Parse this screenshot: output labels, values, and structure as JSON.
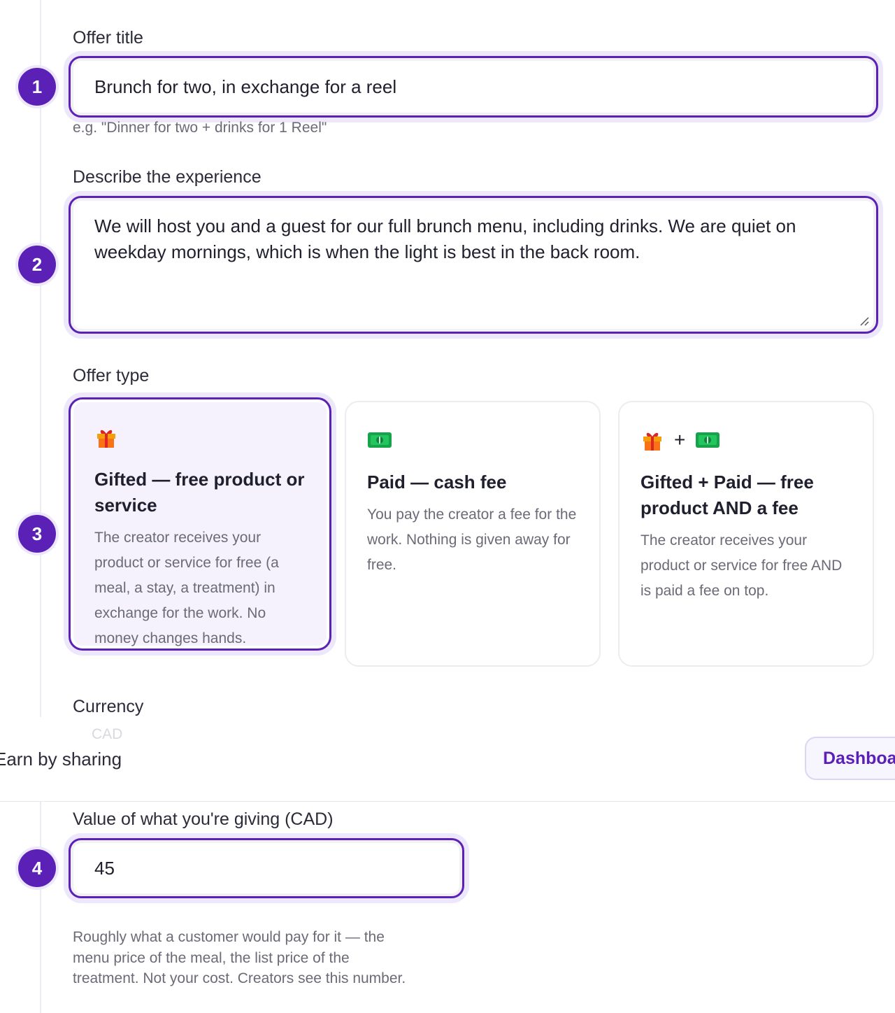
{
  "steps": [
    "1",
    "2",
    "3",
    "4"
  ],
  "offer_title": {
    "label": "Offer title",
    "value": "Brunch for two, in exchange for a reel",
    "hint": "e.g. \"Dinner for two + drinks for 1 Reel\""
  },
  "description": {
    "label": "Describe the experience",
    "value": "We will host you and a guest for our full brunch menu, including drinks. We are quiet on weekday mornings, which is when the light is best in the back room."
  },
  "offer_type": {
    "label": "Offer type",
    "selected": "gifted",
    "options": [
      {
        "title": "Gifted — free product or service",
        "body": "The creator receives your product or service for free (a meal, a stay, a treatment) in exchange for the work. No money changes hands.",
        "icons": [
          "gift-icon"
        ]
      },
      {
        "title": "Paid — cash fee",
        "body": "You pay the creator a fee for the work. Nothing is given away for free.",
        "icons": [
          "cash-icon"
        ]
      },
      {
        "title": "Gifted + Paid — free product AND a fee",
        "body": "The creator receives your product or service for free AND is paid a fee on top.",
        "icons": [
          "gift-icon",
          "cash-icon"
        ],
        "plus": "+"
      }
    ]
  },
  "currency": {
    "label": "Currency",
    "value_partial": "CAD"
  },
  "header": {
    "brand": "Earn by sharing",
    "dashboard_button": "Dashboard"
  },
  "value_field": {
    "label": "Value of what you're giving (CAD)",
    "value": "45",
    "hint_lines": [
      "Roughly what a customer would pay for it — the",
      "menu price of the meal, the list price of the",
      "treatment. Not your cost. Creators see this number."
    ]
  },
  "colors": {
    "accent": "#5b21b6",
    "accent_soft": "#ede7fb",
    "muted_text": "#6b6b78"
  }
}
